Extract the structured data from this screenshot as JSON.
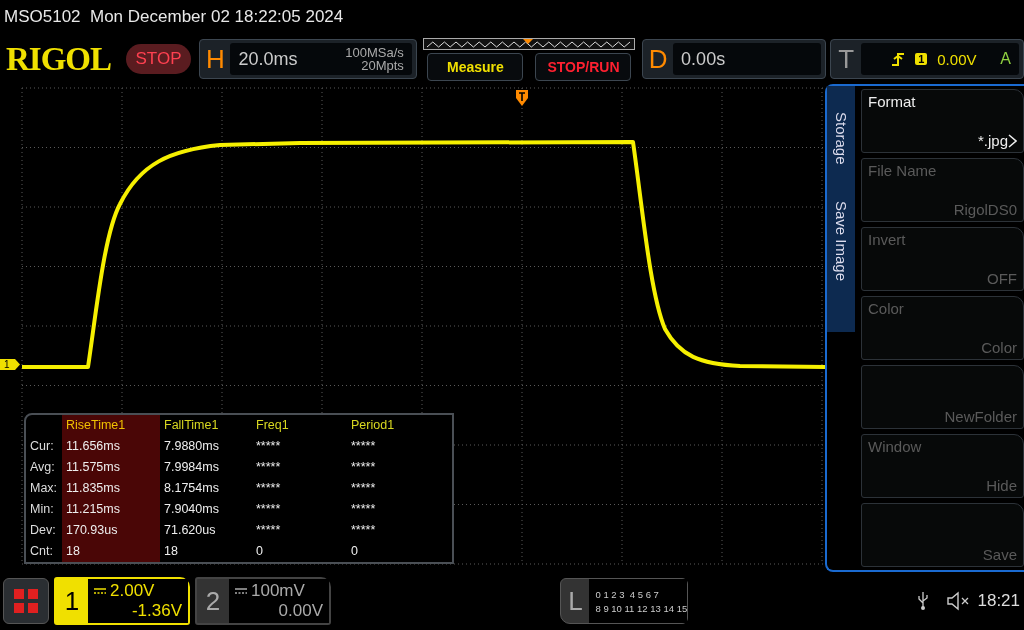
{
  "title_bar": {
    "text": "MSO5102  Mon December 02 18:22:05 2024"
  },
  "toolbar": {
    "logo": "RIGOL",
    "run_state": "STOP",
    "horizontal": {
      "label": "H",
      "scale": "20.0ms",
      "sample_rate": "100MSa/s",
      "memory_depth": "20Mpts"
    },
    "buttons": [
      {
        "label": "Measure",
        "kind": "measure"
      },
      {
        "label": "STOP/RUN",
        "kind": "run"
      }
    ],
    "delay": {
      "label": "D",
      "value": "0.00s"
    },
    "trigger": {
      "label": "T",
      "source": "1",
      "level": "0.00V",
      "mode": "A"
    }
  },
  "display": {
    "channel_marker": "1"
  },
  "measurements": {
    "columns": [
      {
        "label": "RiseTime1",
        "selected": true
      },
      {
        "label": "FallTime1",
        "selected": false
      },
      {
        "label": "Freq1",
        "selected": false
      },
      {
        "label": "Period1",
        "selected": false
      }
    ],
    "rows": [
      {
        "label": "Cur:",
        "values": [
          "11.656ms",
          "7.9880ms",
          "*****",
          "*****"
        ]
      },
      {
        "label": "Avg:",
        "values": [
          "11.575ms",
          "7.9984ms",
          "*****",
          "*****"
        ]
      },
      {
        "label": "Max:",
        "values": [
          "11.835ms",
          "8.1754ms",
          "*****",
          "*****"
        ]
      },
      {
        "label": "Min:",
        "values": [
          "11.215ms",
          "7.9040ms",
          "*****",
          "*****"
        ]
      },
      {
        "label": "Dev:",
        "values": [
          "170.93us",
          "71.620us",
          "*****",
          "*****"
        ]
      },
      {
        "label": "Cnt:",
        "values": [
          "18",
          "18",
          "0",
          "0"
        ]
      }
    ]
  },
  "menu": {
    "title": "Storage",
    "subtitle": "Save Image",
    "items": [
      {
        "label": "Format",
        "value": "*.jpg",
        "disabled": false,
        "submenu": true
      },
      {
        "label": "File Name",
        "value": "RigolDS0",
        "disabled": true,
        "submenu": false
      },
      {
        "label": "Invert",
        "value": "OFF",
        "disabled": true,
        "submenu": false
      },
      {
        "label": "Color",
        "value": "Color",
        "disabled": true,
        "submenu": false
      },
      {
        "value": "NewFolder",
        "disabled": true,
        "submenu": false
      },
      {
        "label": "Window",
        "value": "Hide",
        "disabled": true,
        "submenu": false
      },
      {
        "value": "Save",
        "disabled": true,
        "submenu": false
      }
    ]
  },
  "channels": [
    {
      "number": "1",
      "scale": "2.00V",
      "offset": "-1.36V",
      "selected": true
    },
    {
      "number": "2",
      "scale": "100mV",
      "offset": "0.00V",
      "selected": false
    }
  ],
  "logic": {
    "label": "L",
    "lines": [
      "0 1 2 3  4 5 6 7",
      "8 9 10 11 12 13 14 15"
    ]
  },
  "status": {
    "time": "18:21",
    "muted": true
  }
}
